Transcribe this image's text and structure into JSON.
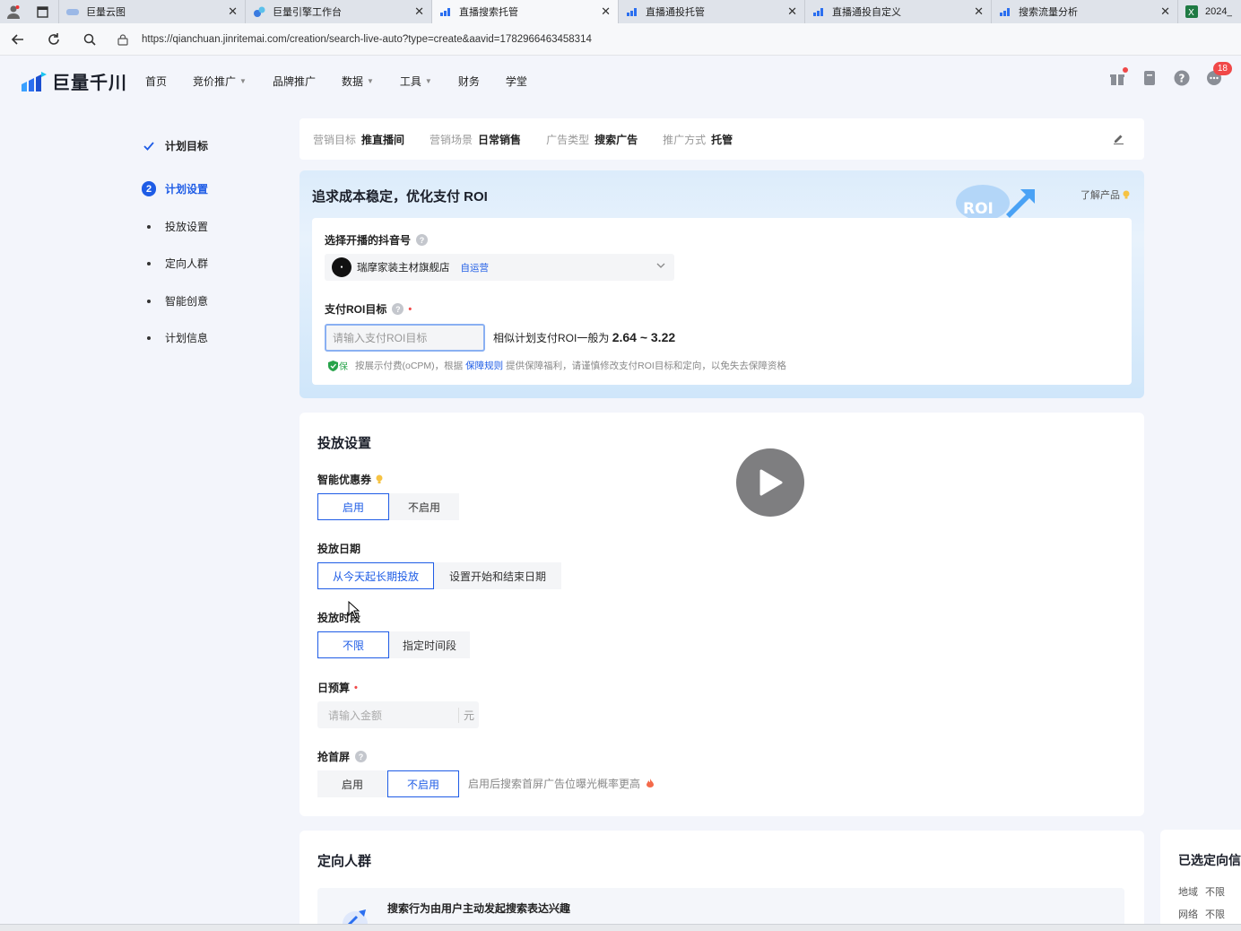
{
  "browser": {
    "tabs": [
      {
        "label": "巨量云图",
        "active": false
      },
      {
        "label": "巨量引擎工作台",
        "active": false
      },
      {
        "label": "直播搜索托管",
        "active": true
      },
      {
        "label": "直播通投托管",
        "active": false
      },
      {
        "label": "直播通投自定义",
        "active": false
      },
      {
        "label": "搜索流量分析",
        "active": false
      },
      {
        "label": "2024_",
        "active": false
      }
    ],
    "url": "https://qianchuan.jinritemai.com/creation/search-live-auto?type=create&aavid=1782966463458314"
  },
  "header": {
    "logo_text": "巨量千川",
    "nav": [
      {
        "label": "首页",
        "dropdown": false
      },
      {
        "label": "竞价推广",
        "dropdown": true
      },
      {
        "label": "品牌推广",
        "dropdown": false
      },
      {
        "label": "数据",
        "dropdown": true
      },
      {
        "label": "工具",
        "dropdown": true
      },
      {
        "label": "财务",
        "dropdown": false
      },
      {
        "label": "学堂",
        "dropdown": false
      }
    ],
    "notification_count": "18"
  },
  "sidebar": {
    "items": [
      {
        "label": "计划目标",
        "marker": "check"
      },
      {
        "label": "计划设置",
        "marker": "2"
      },
      {
        "label": "投放设置",
        "marker": "bullet"
      },
      {
        "label": "定向人群",
        "marker": "bullet"
      },
      {
        "label": "智能创意",
        "marker": "bullet"
      },
      {
        "label": "计划信息",
        "marker": "bullet"
      }
    ]
  },
  "summary": {
    "items": [
      {
        "key": "营销目标",
        "value": "推直播间"
      },
      {
        "key": "营销场景",
        "value": "日常销售"
      },
      {
        "key": "广告类型",
        "value": "搜索广告"
      },
      {
        "key": "推广方式",
        "value": "托管"
      }
    ]
  },
  "roi_card": {
    "title": "追求成本稳定，优化支付 ROI",
    "art_text": "ROI",
    "learn_more": "了解产品",
    "account_label": "选择开播的抖音号",
    "account_name": "瑞摩家装主材旗舰店",
    "account_tag": "自运营",
    "roi_label": "支付ROI目标",
    "required_mark": "•",
    "roi_placeholder": "请输入支付ROI目标",
    "roi_hint_prefix": "相似计划支付ROI一般为",
    "roi_range": "2.64 ~ 3.22",
    "guarantee_badge": "保",
    "guarantee_pre": "按展示付费(oCPM)，根据",
    "guarantee_link": "保障规则",
    "guarantee_post": "提供保障福利，请谨慎修改支付ROI目标和定向，以免失去保障资格"
  },
  "delivery": {
    "title": "投放设置",
    "coupon_label": "智能优惠券",
    "coupon_options": [
      "启用",
      "不启用"
    ],
    "date_label": "投放日期",
    "date_options": [
      "从今天起长期投放",
      "设置开始和结束日期"
    ],
    "time_label": "投放时段",
    "time_options": [
      "不限",
      "指定时间段"
    ],
    "budget_label": "日预算",
    "required_mark": "•",
    "budget_placeholder": "请输入金额",
    "budget_unit": "元",
    "first_screen_label": "抢首屏",
    "first_screen_options": [
      "启用",
      "不启用"
    ],
    "first_screen_hint": "启用后搜索首屏广告位曝光概率更高"
  },
  "targeting": {
    "title": "定向人群",
    "desc": "搜索行为由用户主动发起搜索表达兴趣"
  },
  "right_panel": {
    "title": "已选定向信",
    "rows": [
      {
        "key": "地域",
        "value": "不限"
      },
      {
        "key": "网络",
        "value": "不限"
      }
    ]
  },
  "colors": {
    "accent": "#1e5ce6",
    "required": "#f04848"
  }
}
